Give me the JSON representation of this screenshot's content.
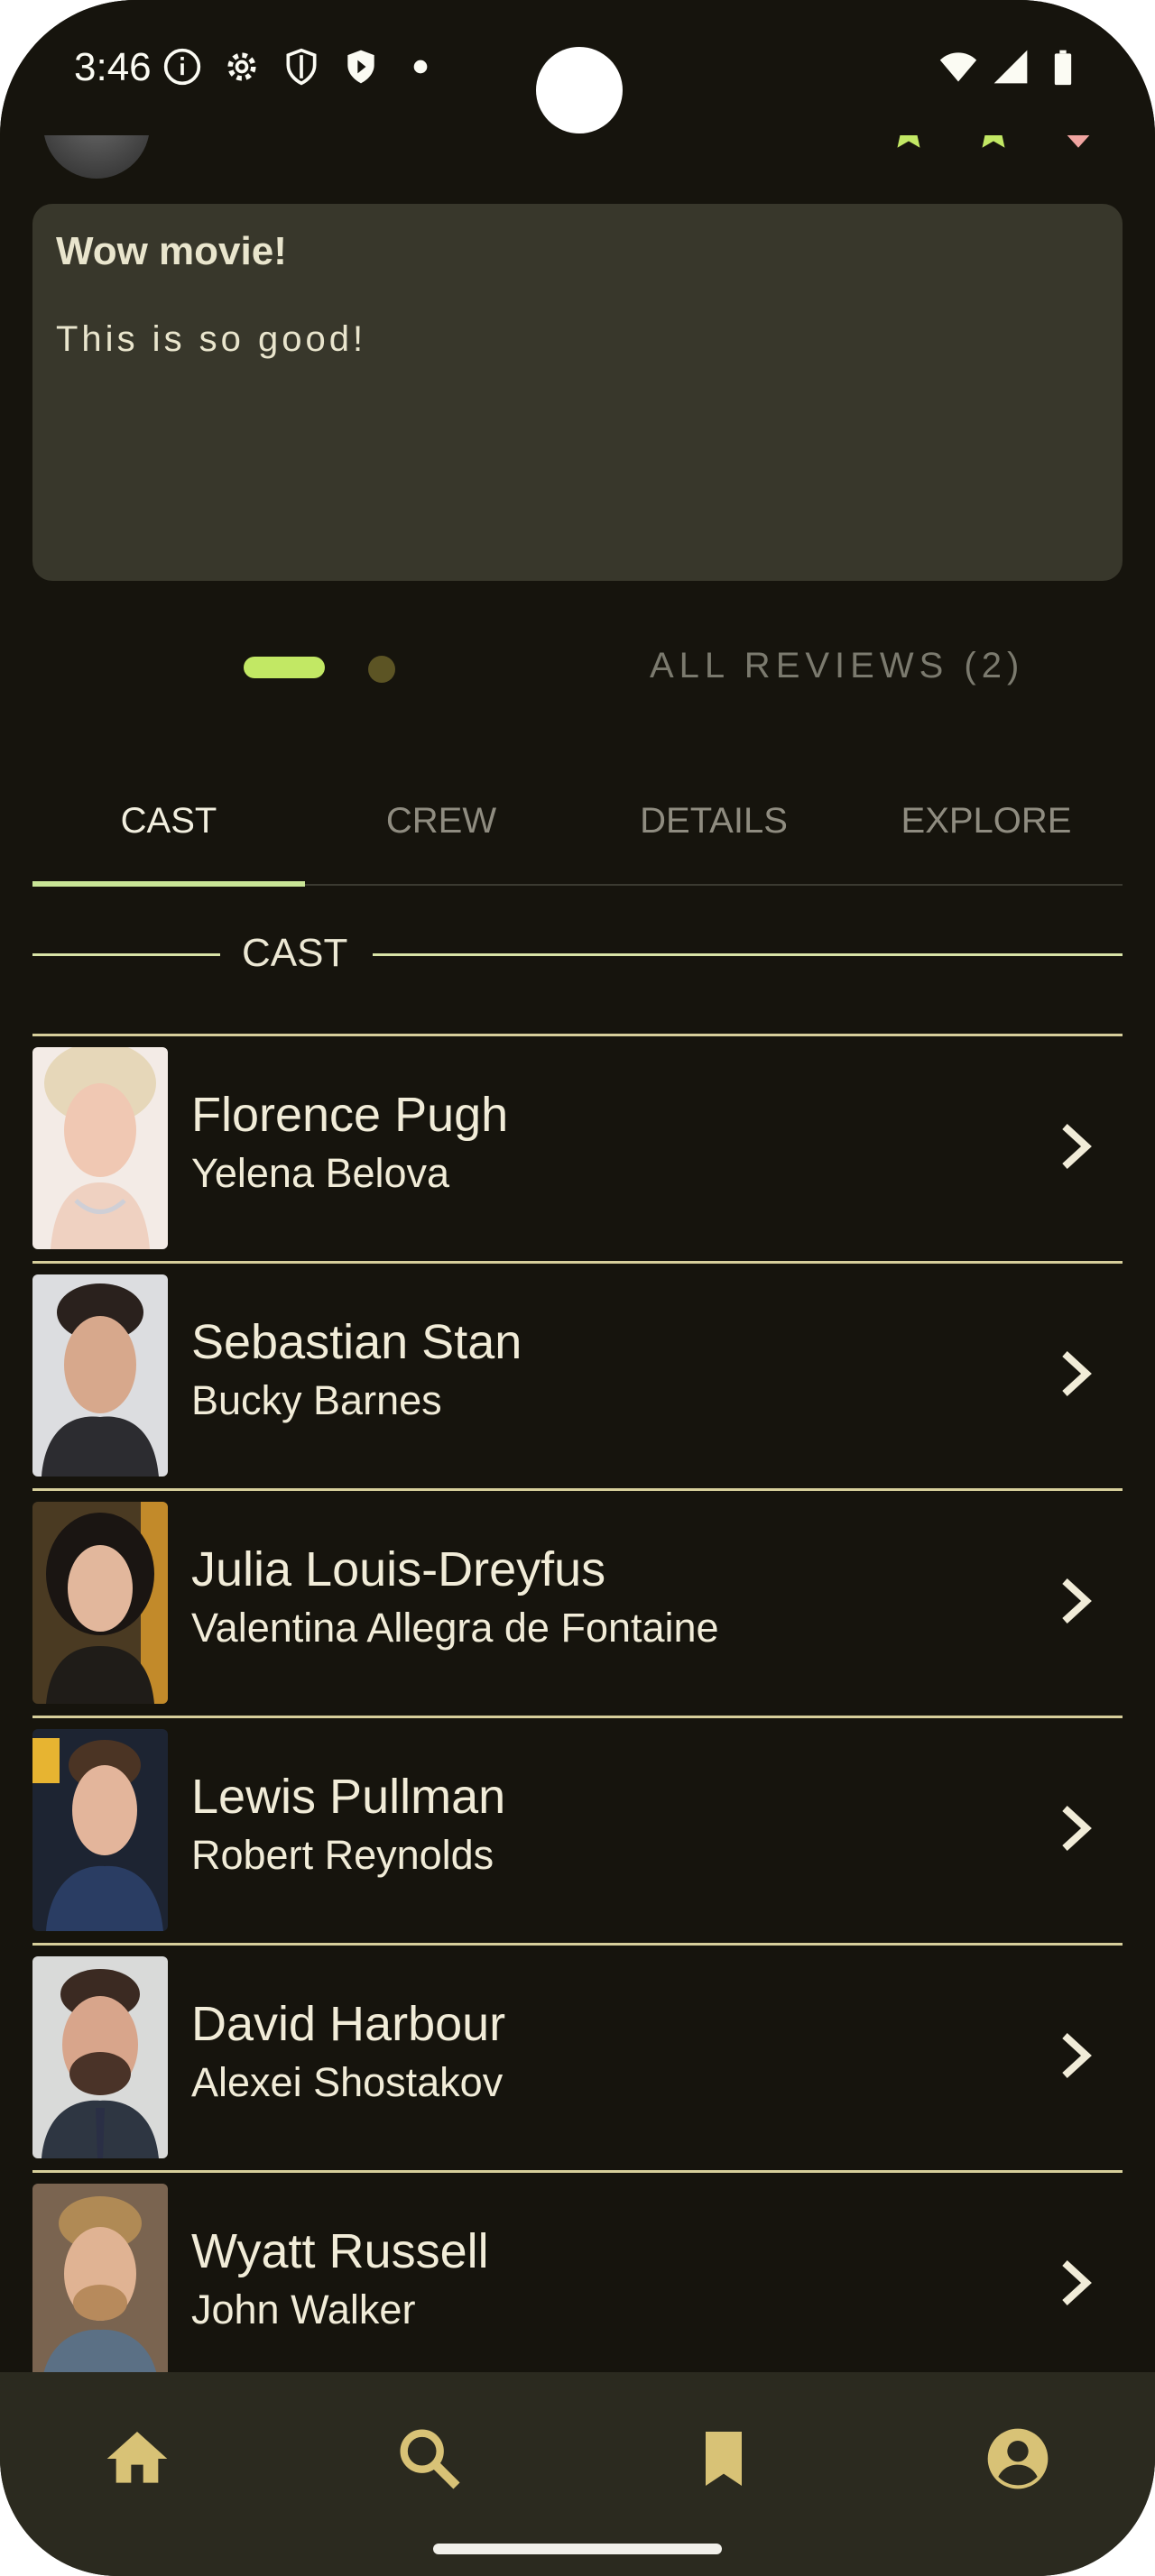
{
  "status_bar": {
    "time": "3:46",
    "left_icons": [
      "info-icon",
      "settings-icon",
      "shield-icon",
      "play-shield-icon",
      "dot-icon"
    ],
    "right_icons": [
      "wifi-icon",
      "signal-icon",
      "battery-icon"
    ]
  },
  "review": {
    "title": "Wow movie!",
    "body": "This is so good!",
    "stars": [
      "star-filled-icon",
      "star-filled-icon",
      "heart-icon"
    ]
  },
  "pager": {
    "all_reviews_label": "ALL REVIEWS (2)"
  },
  "tabs": [
    {
      "label": "CAST",
      "active": true
    },
    {
      "label": "CREW",
      "active": false
    },
    {
      "label": "DETAILS",
      "active": false
    },
    {
      "label": "EXPLORE",
      "active": false
    }
  ],
  "cast_section": {
    "header": "CAST",
    "members": [
      {
        "actor": "Florence Pugh",
        "role": "Yelena Belova"
      },
      {
        "actor": "Sebastian Stan",
        "role": "Bucky Barnes"
      },
      {
        "actor": "Julia Louis-Dreyfus",
        "role": "Valentina Allegra de Fontaine"
      },
      {
        "actor": "Lewis Pullman",
        "role": "Robert Reynolds"
      },
      {
        "actor": "David Harbour",
        "role": "Alexei Shostakov"
      },
      {
        "actor": "Wyatt Russell",
        "role": "John Walker"
      }
    ]
  },
  "bottom_nav": {
    "items": [
      "home-icon",
      "search-icon",
      "bookmark-icon",
      "account-icon"
    ],
    "icon_color": "#d8c276"
  },
  "colors": {
    "background": "#16140d",
    "accent": "#c2e864",
    "card": "#38372b",
    "divider": "#d7cf9b"
  }
}
